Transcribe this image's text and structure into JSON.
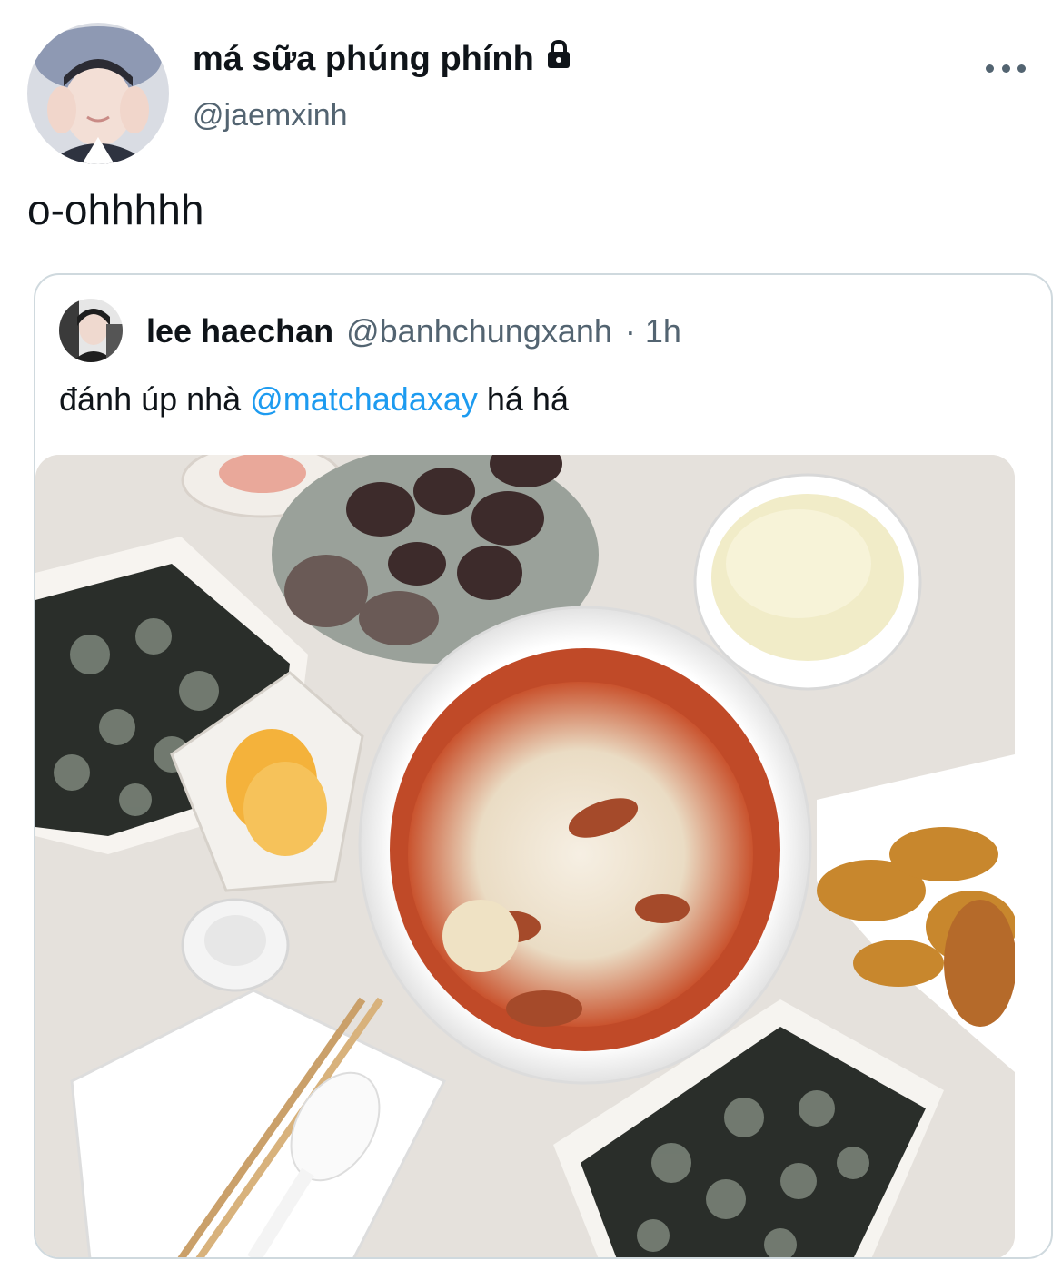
{
  "tweet": {
    "author": {
      "display_name": "má sữa phúng phính",
      "handle": "@jaemxinh",
      "protected_icon": "lock-icon"
    },
    "text": "o-ohhhhh",
    "more_icon": "more-horizontal-icon"
  },
  "quoted": {
    "author": {
      "display_name": "lee haechan",
      "handle": "@banhchungxanh",
      "time": "· 1h"
    },
    "text_before": "đánh úp nhà ",
    "mention": "@matchadaxay",
    "text_after": " há há",
    "media_description_icon": "food-photo"
  },
  "colors": {
    "link": "#1d9bf0",
    "secondary_text": "#536471",
    "border": "#cfd9de"
  }
}
